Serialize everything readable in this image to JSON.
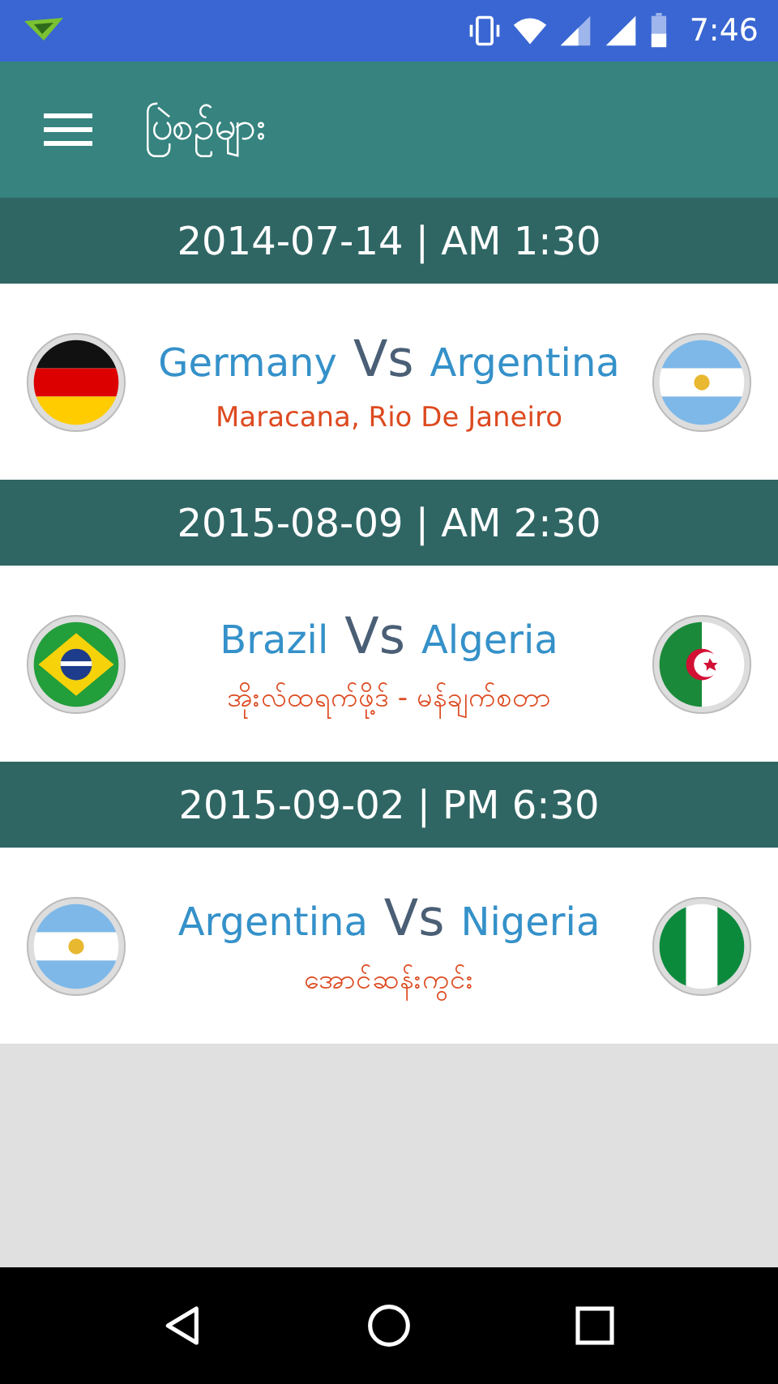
{
  "status_bar": {
    "time": "7:46"
  },
  "toolbar": {
    "title": "ပြဲစဉ်များ"
  },
  "matches": [
    {
      "date": "2014-07-14 | AM 1:30",
      "home": {
        "name": "Germany",
        "kind": "germany"
      },
      "vs": "Vs",
      "away": {
        "name": "Argentina",
        "kind": "argentina"
      },
      "venue": "Maracana, Rio De Janeiro"
    },
    {
      "date": "2015-08-09 | AM 2:30",
      "home": {
        "name": "Brazil",
        "kind": "brazil"
      },
      "vs": "Vs",
      "away": {
        "name": "Algeria",
        "kind": "algeria"
      },
      "venue": "အိုးလ်ထရက်ဖို့ဒ် - မန်ချက်စတာ"
    },
    {
      "date": "2015-09-02 | PM 6:30",
      "home": {
        "name": "Argentina",
        "kind": "argentina"
      },
      "vs": "Vs",
      "away": {
        "name": "Nigeria",
        "kind": "nigeria"
      },
      "venue": "အောင်ဆန်းကွင်း"
    }
  ]
}
